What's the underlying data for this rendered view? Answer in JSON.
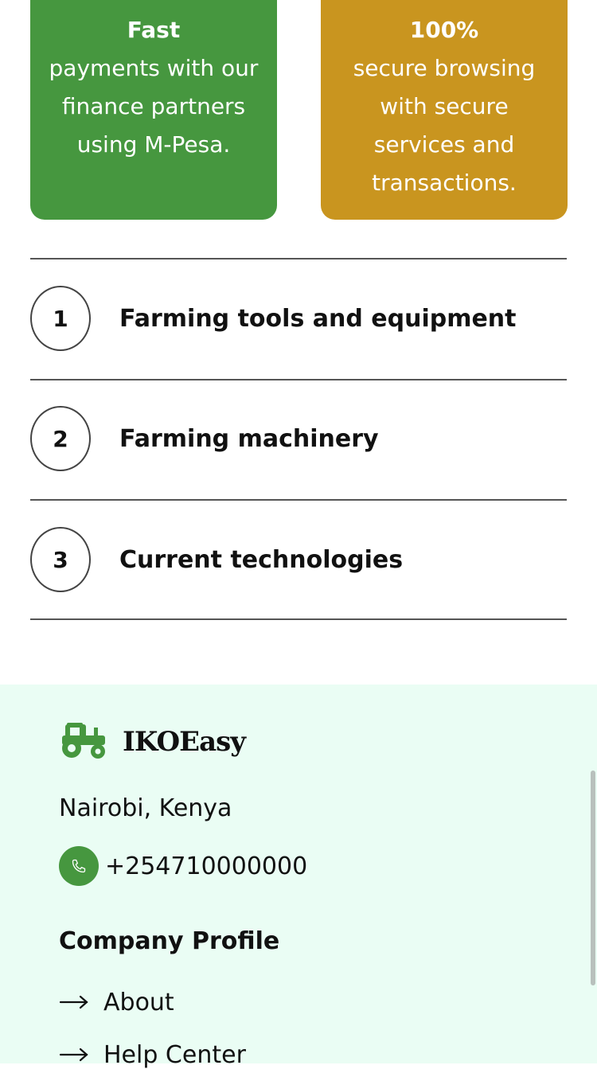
{
  "cards": [
    {
      "title": "Fast",
      "text": "payments with our finance partners using M-Pesa.",
      "color": "#46973f"
    },
    {
      "title": "100%",
      "text": "secure browsing with secure services and transactions.",
      "color": "#c9951f"
    }
  ],
  "features": [
    {
      "number": "1",
      "label": "Farming tools and equipment"
    },
    {
      "number": "2",
      "label": "Farming machinery"
    },
    {
      "number": "3",
      "label": "Current technologies"
    }
  ],
  "footer": {
    "brand": "IKOEasy",
    "logo_icon": "tractor-icon",
    "address": "Nairobi, Kenya",
    "phone": "+254710000000",
    "phone_icon": "phone-icon",
    "section_title": "Company Profile",
    "links": [
      {
        "label": "About"
      },
      {
        "label": "Help Center"
      }
    ],
    "background": "#eafdf4",
    "accent": "#46973f"
  }
}
